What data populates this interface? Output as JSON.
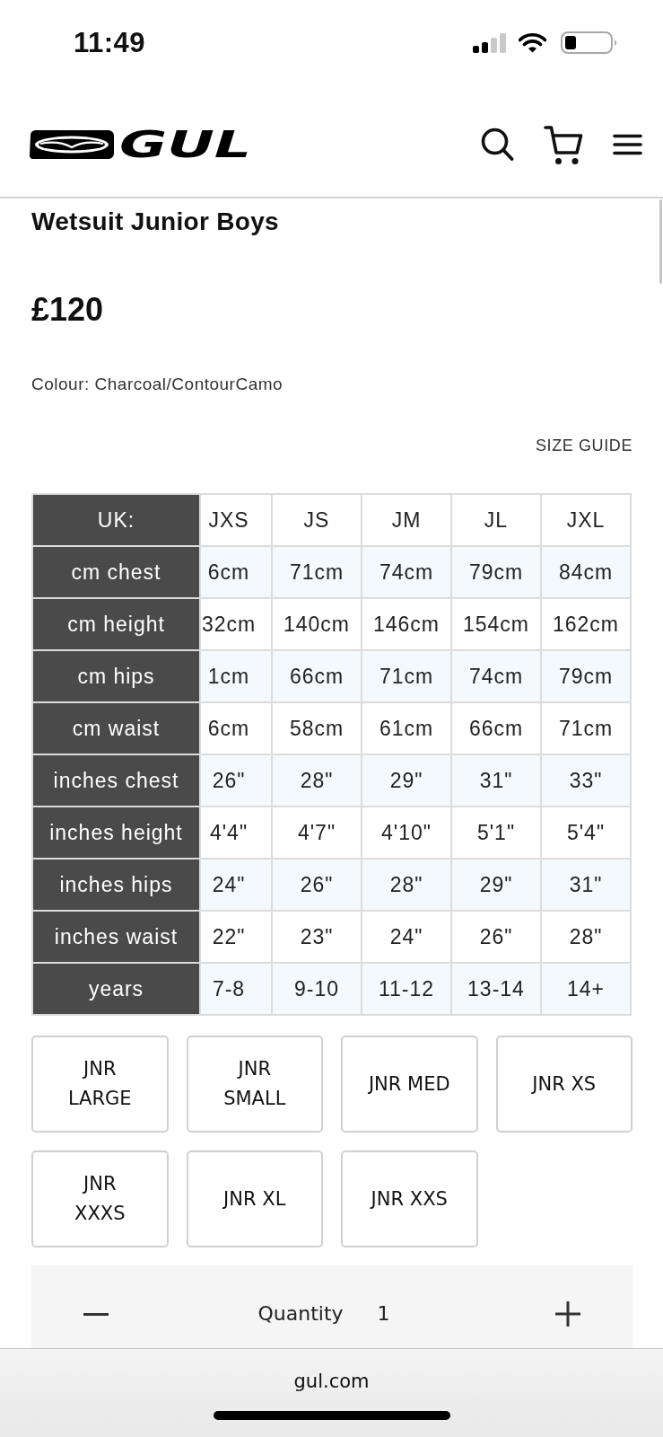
{
  "status_bar": {
    "time": "11:49"
  },
  "header": {
    "logo_text": "GUL"
  },
  "product": {
    "title": "Wetsuit Junior Boys",
    "price": "£120",
    "colour": "Colour: Charcoal/ContourCamo",
    "size_guide_link": "SIZE GUIDE"
  },
  "size_chart": {
    "columns": [
      "UK:",
      "JXS",
      "JS",
      "JM",
      "JL",
      "JXL"
    ],
    "rows": [
      {
        "cells": [
          "cm chest",
          "6cm",
          "71cm",
          "74cm",
          "79cm",
          "84cm"
        ]
      },
      {
        "cells": [
          "cm height",
          "32cm",
          "140cm",
          "146cm",
          "154cm",
          "162cm"
        ]
      },
      {
        "cells": [
          "cm hips",
          "1cm",
          "66cm",
          "71cm",
          "74cm",
          "79cm"
        ]
      },
      {
        "cells": [
          "cm waist",
          "6cm",
          "58cm",
          "61cm",
          "66cm",
          "71cm"
        ]
      },
      {
        "cells": [
          "inches chest",
          "26\"",
          "28\"",
          "29\"",
          "31\"",
          "33\""
        ]
      },
      {
        "cells": [
          "inches height",
          "4'4\"",
          "4'7\"",
          "4'10\"",
          "5'1\"",
          "5'4\""
        ]
      },
      {
        "cells": [
          "inches hips",
          "24\"",
          "26\"",
          "28\"",
          "29\"",
          "31\""
        ]
      },
      {
        "cells": [
          "inches waist",
          "22\"",
          "23\"",
          "24\"",
          "26\"",
          "28\""
        ]
      },
      {
        "cells": [
          "years",
          "7-8",
          "9-10",
          "11-12",
          "13-14",
          "14+"
        ]
      }
    ]
  },
  "sizes": [
    "JNR LARGE",
    "JNR SMALL",
    "JNR MED",
    "JNR XS",
    "JNR XXXS",
    "JNR XL",
    "JNR XXS"
  ],
  "quantity": {
    "label": "Quantity",
    "value": "1"
  },
  "browser_bar": {
    "url": "gul.com"
  }
}
